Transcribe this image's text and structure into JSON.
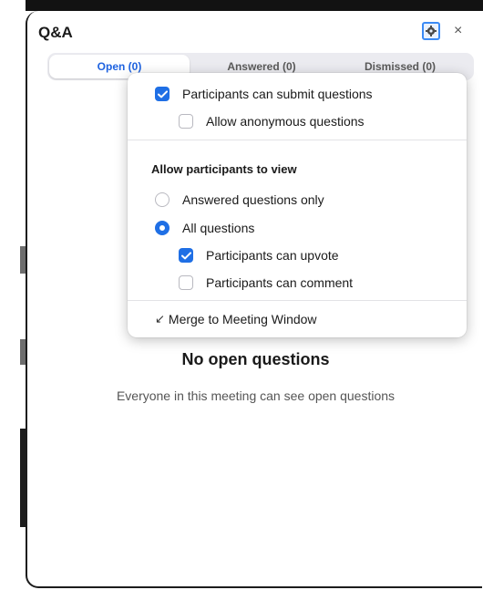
{
  "qa": {
    "title": "Q&A",
    "gear_icon": "gear-icon",
    "close_label": "×",
    "tabs": [
      {
        "label": "Open (0)"
      },
      {
        "label": "Answered (0)"
      },
      {
        "label": "Dismissed (0)"
      }
    ],
    "empty_title": "No open questions",
    "empty_subtitle": "Everyone in this meeting can see open questions"
  },
  "settings": {
    "submit_questions": {
      "label": "Participants can submit questions",
      "checked": true
    },
    "anonymous_questions": {
      "label": "Allow anonymous questions",
      "checked": false
    },
    "view_section_title": "Allow participants to view",
    "answered_only": {
      "label": "Answered questions only",
      "selected": false
    },
    "all_questions": {
      "label": "All questions",
      "selected": true
    },
    "can_upvote": {
      "label": "Participants can upvote",
      "checked": true
    },
    "can_comment": {
      "label": "Participants can comment",
      "checked": false
    },
    "merge_label": "Merge to Meeting Window",
    "merge_icon": "arrow-down-left-icon"
  },
  "colors": {
    "accent": "#1f6fe5",
    "tab_active_text": "#1f63e0"
  }
}
